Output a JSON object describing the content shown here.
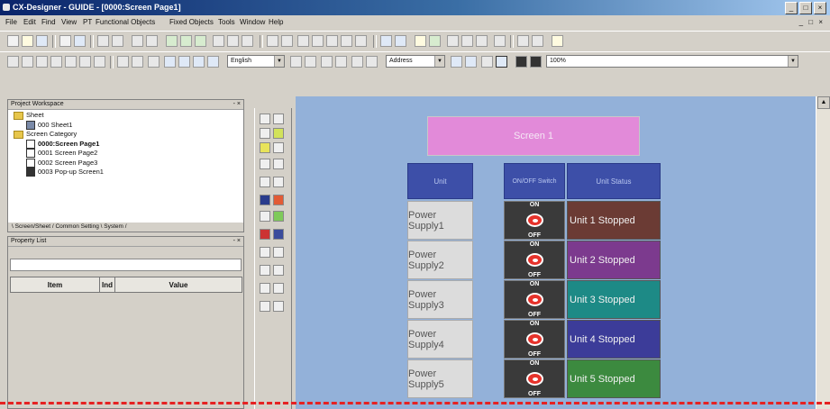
{
  "window": {
    "title": "CX-Designer - GUIDE - [0000:Screen Page1]",
    "min": "_",
    "max": "□",
    "close": "×"
  },
  "menu": [
    "File",
    "Edit",
    "Find",
    "View",
    "PT",
    "Functional Objects",
    "Fixed Objects",
    "Tools",
    "Window",
    "Help"
  ],
  "toolbar2": {
    "language": "English",
    "address": "Address",
    "zoom": "100%"
  },
  "project_workspace": {
    "title": "Project Workspace",
    "tree": [
      {
        "label": "Sheet",
        "kind": "folder"
      },
      {
        "label": "000 Sheet1",
        "kind": "sheet"
      },
      {
        "label": "Screen Category",
        "kind": "folder"
      },
      {
        "label": "0000:Screen Page1",
        "kind": "page",
        "selected": true
      },
      {
        "label": "0001 Screen Page2",
        "kind": "page"
      },
      {
        "label": "0002 Screen Page3",
        "kind": "page"
      },
      {
        "label": "0003 Pop-up Screen1",
        "kind": "popup"
      }
    ],
    "tabs": [
      "Screen/Sheet",
      "Common Setting",
      "System"
    ]
  },
  "property_list": {
    "title": "Property List",
    "columns": [
      "Item",
      "Ind",
      "Value"
    ]
  },
  "screen": {
    "name": "Screen 1",
    "headers": [
      "Unit",
      "ON/OFF Switch",
      "Unit Status"
    ],
    "rows": [
      {
        "unit": "Power Supply1",
        "on": "ON",
        "off": "OFF",
        "status": "Unit 1 Stopped",
        "color": "#6b3b34"
      },
      {
        "unit": "Power Supply2",
        "on": "ON",
        "off": "OFF",
        "status": "Unit 2 Stopped",
        "color": "#7c3a8e"
      },
      {
        "unit": "Power Supply3",
        "on": "ON",
        "off": "OFF",
        "status": "Unit 3 Stopped",
        "color": "#1d8a86"
      },
      {
        "unit": "Power Supply4",
        "on": "ON",
        "off": "OFF",
        "status": "Unit 4 Stopped",
        "color": "#3c3c99"
      },
      {
        "unit": "Power Supply5",
        "on": "ON",
        "off": "OFF",
        "status": "Unit 5 Stopped",
        "color": "#3c8a3f"
      }
    ]
  }
}
